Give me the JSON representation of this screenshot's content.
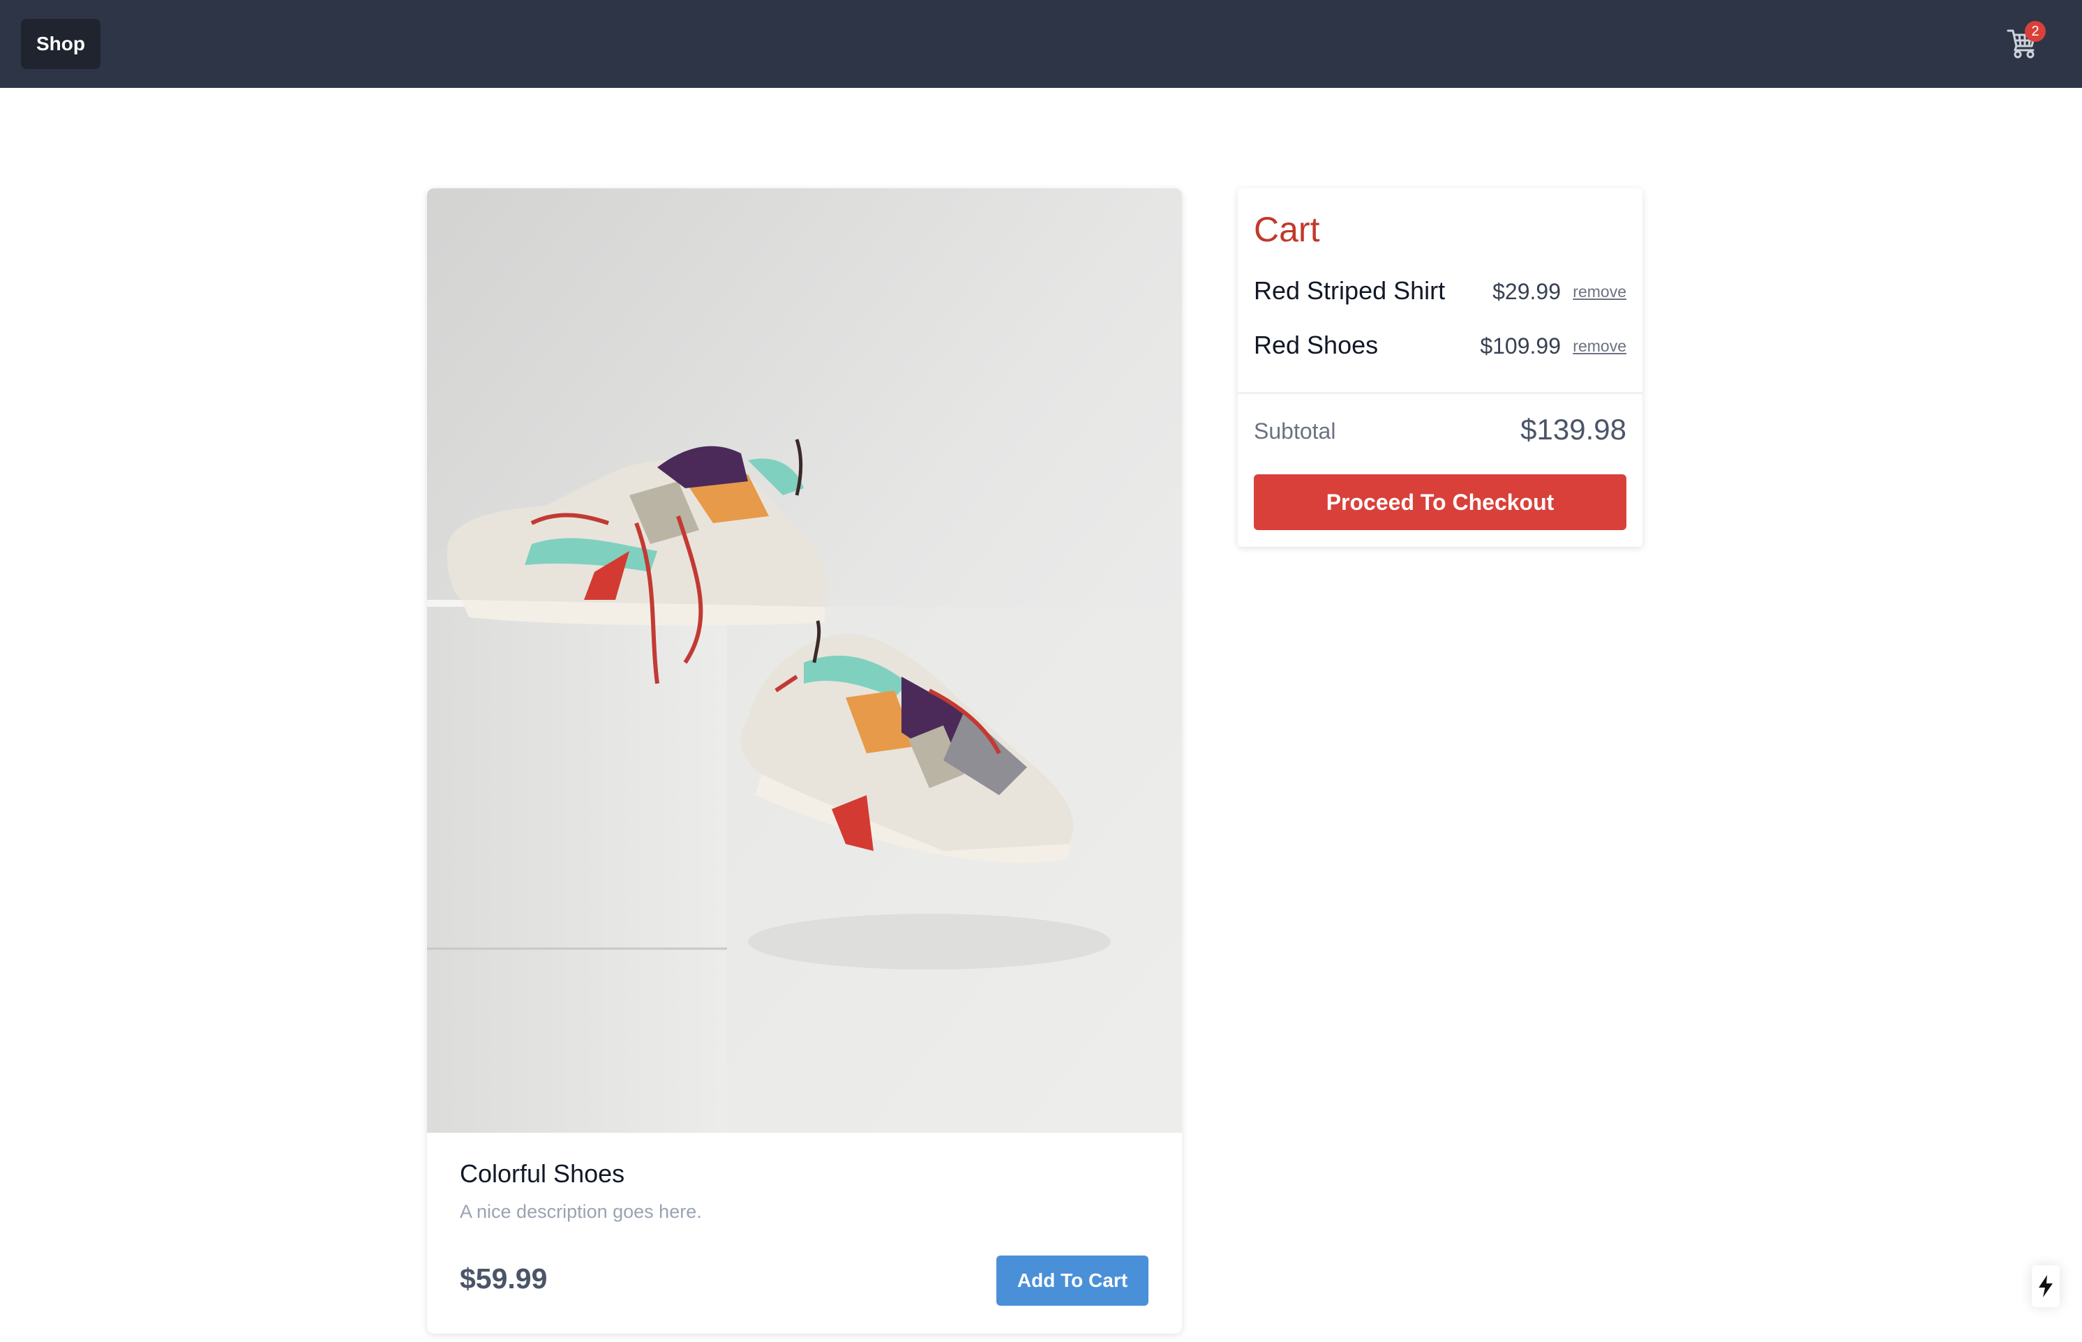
{
  "nav": {
    "shop_label": "Shop",
    "cart_count": "2"
  },
  "product": {
    "title": "Colorful Shoes",
    "description": "A nice description goes here.",
    "price": "$59.99",
    "add_to_cart_label": "Add To Cart",
    "image_alt": "sneakers on white block"
  },
  "cart": {
    "title": "Cart",
    "items": [
      {
        "name": "Red Striped Shirt",
        "price": "$29.99",
        "remove_label": "remove"
      },
      {
        "name": "Red Shoes",
        "price": "$109.99",
        "remove_label": "remove"
      }
    ],
    "subtotal_label": "Subtotal",
    "subtotal_value": "$139.98",
    "checkout_label": "Proceed To Checkout"
  },
  "colors": {
    "topbar": "#2d3546",
    "accent_red": "#d9403a",
    "accent_blue": "#4a90d9"
  },
  "icons": {
    "cart": "cart-icon",
    "floating": "lightning-icon"
  }
}
